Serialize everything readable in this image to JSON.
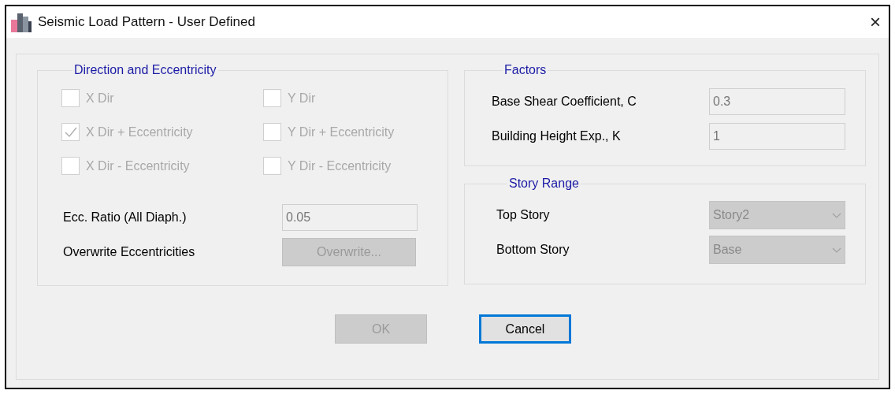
{
  "window": {
    "title": "Seismic Load Pattern - User Defined",
    "close": "×"
  },
  "direction": {
    "title": "Direction and Eccentricity",
    "options": [
      {
        "label": "X Dir",
        "checked": false,
        "disabled": true
      },
      {
        "label": "Y Dir",
        "checked": false,
        "disabled": true
      },
      {
        "label": "X Dir + Eccentricity",
        "checked": true,
        "disabled": true
      },
      {
        "label": "Y Dir + Eccentricity",
        "checked": false,
        "disabled": true
      },
      {
        "label": "X Dir - Eccentricity",
        "checked": false,
        "disabled": true
      },
      {
        "label": "Y Dir - Eccentricity",
        "checked": false,
        "disabled": true
      }
    ],
    "ecc_ratio": {
      "label": "Ecc. Ratio (All Diaph.)",
      "value": "0.05"
    },
    "overwrite": {
      "label": "Overwrite Eccentricities",
      "button": "Overwrite...",
      "disabled": true
    }
  },
  "factors": {
    "title": "Factors",
    "fields": [
      {
        "label": "Base Shear Coefficient, C",
        "value": "0.3"
      },
      {
        "label": "Building Height Exp., K",
        "value": "1"
      }
    ]
  },
  "story_range": {
    "title": "Story Range",
    "dropdowns": [
      {
        "label": "Top Story",
        "value": "Story2",
        "disabled": true
      },
      {
        "label": "Bottom Story",
        "value": "Base",
        "disabled": true
      }
    ]
  },
  "buttons": [
    {
      "label": "OK",
      "disabled": true,
      "focused": false
    },
    {
      "label": "Cancel",
      "disabled": false,
      "focused": true
    }
  ]
}
